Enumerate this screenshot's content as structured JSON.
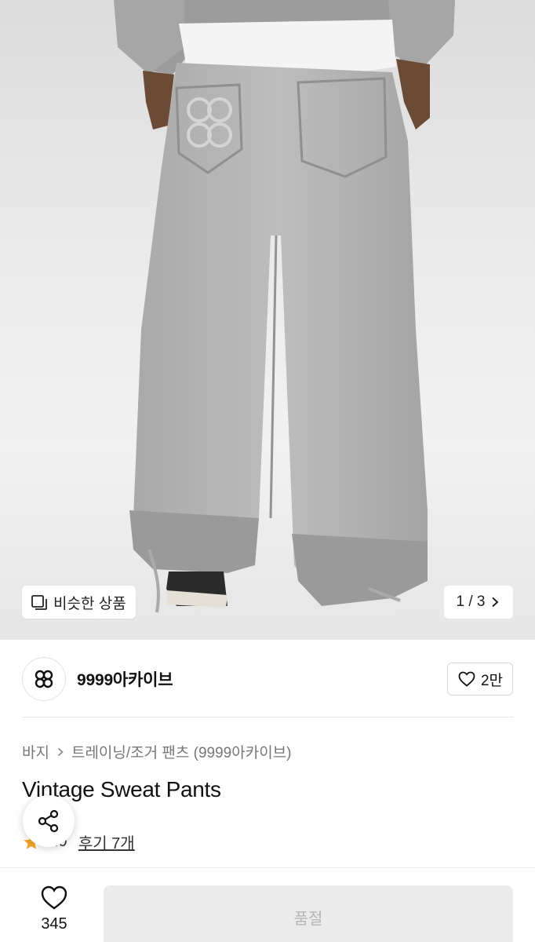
{
  "hero": {
    "image_alt": "gray sweat pants rear view",
    "similar_label": "비슷한 상품",
    "similar_icon": "similar-items-icon",
    "pager_text": "1 / 3",
    "pager_icon": "chevron-right-icon"
  },
  "brand": {
    "name": "9999아카이브",
    "logo_icon": "brand-logo-icon",
    "like_count": "2만",
    "like_icon": "heart-outline-icon"
  },
  "breadcrumb": {
    "category": "바지",
    "subcategory": "트레이닝/조거 팬츠 (9999아카이브)"
  },
  "product": {
    "title": "Vintage Sweat Pants",
    "rating": "4.9",
    "review_text": "후기 7개"
  },
  "share_icon": "share-icon",
  "bottom": {
    "wish_count": "345",
    "buy_label": "품절"
  },
  "colors": {
    "accent_star": "#f5a623",
    "soldout_bg": "#ebebeb",
    "soldout_text": "#b5b5b5"
  }
}
